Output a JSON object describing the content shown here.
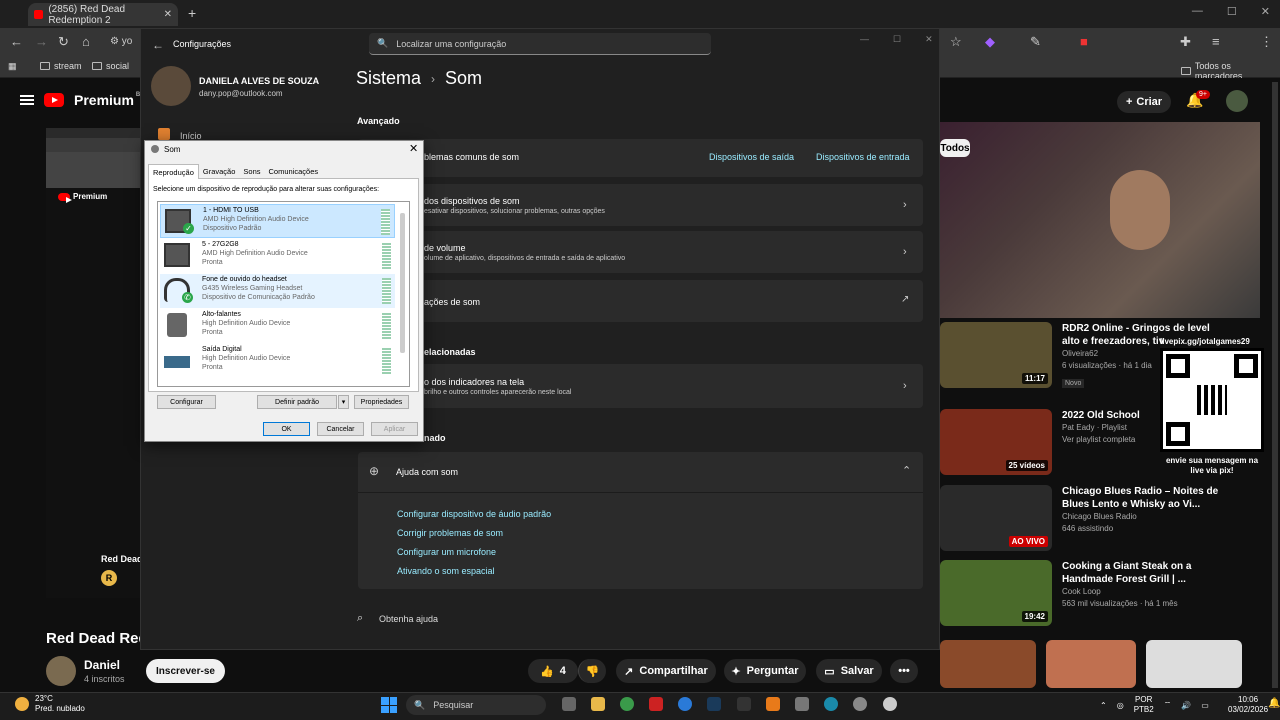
{
  "browser": {
    "tab_title": "(2856) Red Dead Redemption 2",
    "address_prefix": "yo",
    "bookmarks": [
      "stream",
      "social"
    ],
    "bookmarks_all": "Todos os marcadores"
  },
  "youtube": {
    "logo_text": "Premium",
    "country": "BR",
    "criar": "Criar",
    "notif_count": "9+",
    "filter_chip": "Todos",
    "video_small_title": "Red Dead",
    "video_title": "Red Dead Red",
    "channel": "Daniel",
    "subs": "4 inscritos",
    "subscribe": "Inscrever-se",
    "likes": "4",
    "share": "Compartilhar",
    "ask": "Perguntar",
    "save": "Salvar",
    "qr_top": "livepix.gg/jotalgames29",
    "qr_caption": "envie sua mensagem na live via pix!",
    "recs": [
      {
        "title": "RDR2 Online - Gringos de level alto e freezadores, tiv",
        "meta1": "Oliveira62",
        "meta2": "6 visualizações · há 1 dia",
        "badge": "Novo",
        "dur": "11:17",
        "color": "#5a5030"
      },
      {
        "title": "2022 Old School",
        "meta1": "Pat Eady · Playlist",
        "meta2": "Ver playlist completa",
        "badge": "",
        "dur": "25 vídeos",
        "color": "#7a2a1a"
      },
      {
        "title": "Chicago Blues Radio – Noites de Blues Lento e Whisky ao Vi...",
        "meta1": "Chicago Blues Radio",
        "meta2": "646 assistindo",
        "badge": "",
        "dur": "AO VIVO",
        "color": "#2a2a2a"
      },
      {
        "title": "Cooking a Giant Steak on a Handmade Forest Grill | ...",
        "meta1": "Cook Loop",
        "meta2": "563 mil visualizações · há 1 mês",
        "badge": "",
        "dur": "19:42",
        "color": "#4a6a2a"
      }
    ]
  },
  "settings": {
    "title": "Configurações",
    "search_placeholder": "Localizar uma configuração",
    "user_name": "DANIELA ALVES DE SOUZA",
    "user_email": "dany.pop@outlook.com",
    "nav_home": "Início",
    "bread_parent": "Sistema",
    "bread_current": "Som",
    "section_advanced": "Avançado",
    "troubleshoot": "blemas comuns de som",
    "out_devices": "Dispositivos de saída",
    "in_devices": "Dispositivos de entrada",
    "all_devices": "dos dispositivos de som",
    "all_devices_sub": "esativar dispositivos, solucionar problemas, outras opções",
    "mixer": "de volume",
    "mixer_sub": "olume de aplicativo, dispositivos de entrada e saída de aplicativo",
    "more": "ações de som",
    "section_related": "elacionadas",
    "indicators": "o dos indicadores na tela",
    "indicators_sub": "brilho e outros controles aparecerão neste local",
    "section_help": "nado",
    "help_title": "Ajuda com som",
    "help_links": [
      "Configurar dispositivo de áudio padrão",
      "Corrigir problemas de som",
      "Configurar um microfone",
      "Ativando o som espacial"
    ],
    "get_help": "Obtenha ajuda"
  },
  "sound_dialog": {
    "title": "Som",
    "tabs": [
      "Reprodução",
      "Gravação",
      "Sons",
      "Comunicações"
    ],
    "instruction": "Selecione um dispositivo de reprodução para alterar suas configurações:",
    "devices": [
      {
        "name": "1 - HDMI TO USB",
        "driver": "AMD High Definition Audio Device",
        "status": "Dispositivo Padrão"
      },
      {
        "name": "5 - 27G2G8",
        "driver": "AMD High Definition Audio Device",
        "status": "Pronta"
      },
      {
        "name": "Fone de ouvido do headset",
        "driver": "G435 Wireless Gaming Headset",
        "status": "Dispositivo de Comunicação Padrão"
      },
      {
        "name": "Alto-falantes",
        "driver": "High Definition Audio Device",
        "status": "Pronta"
      },
      {
        "name": "Saída Digital",
        "driver": "High Definition Audio Device",
        "status": "Pronta"
      }
    ],
    "configure": "Configurar",
    "set_default": "Definir padrão",
    "properties": "Propriedades",
    "ok": "OK",
    "cancel": "Cancelar",
    "apply": "Aplicar"
  },
  "taskbar": {
    "temp": "23°C",
    "weather": "Pred. nublado",
    "search": "Pesquisar",
    "lang": "POR",
    "kbd": "PTB2",
    "time": "10:06",
    "date": "03/02/2026"
  }
}
